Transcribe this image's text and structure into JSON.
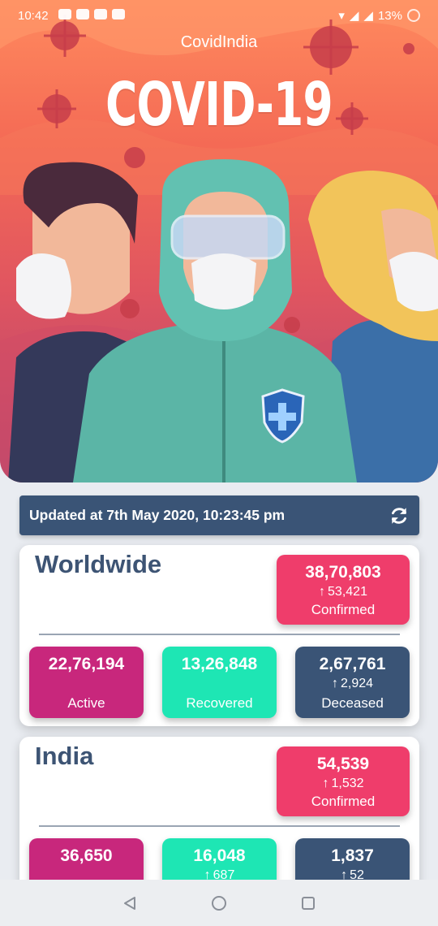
{
  "status_bar": {
    "time": "10:42",
    "battery": "13%"
  },
  "app": {
    "title": "CovidIndia",
    "hero_heading": "COVID-19"
  },
  "updated": {
    "label": "Updated at  7th May 2020, 10:23:45 pm"
  },
  "worldwide": {
    "title": "Worldwide",
    "confirmed": {
      "value": "38,70,803",
      "delta": "53,421",
      "label": "Confirmed"
    },
    "active": {
      "value": "22,76,194",
      "label": "Active"
    },
    "recovered": {
      "value": "13,26,848",
      "label": "Recovered"
    },
    "deceased": {
      "value": "2,67,761",
      "delta": "2,924",
      "label": "Deceased"
    }
  },
  "india": {
    "title": "India",
    "confirmed": {
      "value": "54,539",
      "delta": "1,532",
      "label": "Confirmed"
    },
    "active": {
      "value": "36,650"
    },
    "recovered": {
      "value": "16,048",
      "delta": "687"
    },
    "deceased": {
      "value": "1,837",
      "delta": "52"
    }
  },
  "colors": {
    "confirmed": "#ef3d6b",
    "active": "#c8277c",
    "recovered": "#1ee6b4",
    "deceased": "#3a5476",
    "heading": "#3d5474"
  },
  "icons": {
    "refresh": "refresh-icon",
    "back": "back-triangle-icon",
    "home": "home-circle-icon",
    "recents": "recents-square-icon"
  }
}
